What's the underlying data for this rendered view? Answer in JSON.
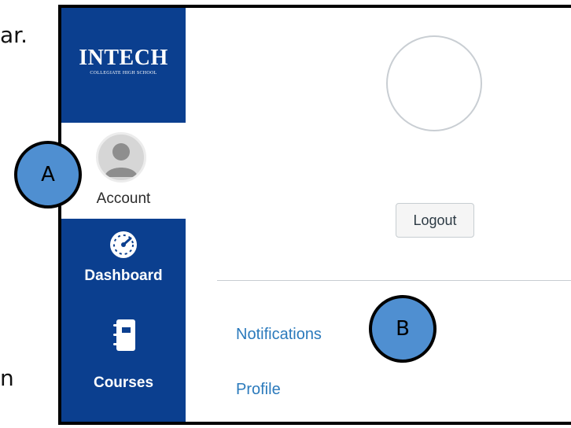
{
  "document": {
    "text_fragment_top": "ar.",
    "text_fragment_bottom": "n"
  },
  "sidebar": {
    "brand_name": "INTECH",
    "brand_subtitle": "COLLEGIATE HIGH SCHOOL",
    "items": [
      {
        "label": "Account",
        "icon": "user-avatar-icon",
        "active": true
      },
      {
        "label": "Dashboard",
        "icon": "speedometer-icon",
        "active": false
      },
      {
        "label": "Courses",
        "icon": "notebook-icon",
        "active": false
      }
    ]
  },
  "account_tray": {
    "logout_label": "Logout",
    "links": [
      {
        "label": "Notifications"
      },
      {
        "label": "Profile"
      }
    ]
  },
  "callouts": [
    {
      "letter": "A"
    },
    {
      "letter": "B"
    }
  ],
  "colors": {
    "sidebar_bg": "#0b3f8f",
    "link": "#2b7abc",
    "callout_fill": "#4f8fd1"
  }
}
